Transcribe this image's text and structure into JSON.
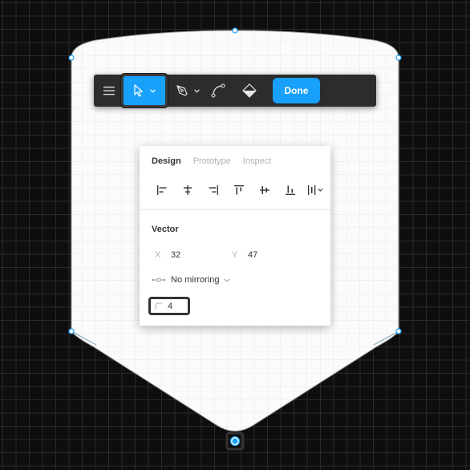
{
  "toolbar": {
    "menu_icon": "hamburger-menu-icon",
    "select_tool_icon": "cursor-arrow-icon",
    "pen_tool_icon": "pen-icon",
    "bend_tool_icon": "bend-curve-icon",
    "fill_tool_icon": "paint-bucket-icon",
    "done_label": "Done"
  },
  "panel": {
    "tabs": [
      {
        "label": "Design",
        "active": true
      },
      {
        "label": "Prototype",
        "active": false
      },
      {
        "label": "Inspect",
        "active": false
      }
    ],
    "align_icons": [
      "align-left-icon",
      "align-horizontal-center-icon",
      "align-right-icon",
      "align-top-icon",
      "align-vertical-center-icon",
      "align-bottom-icon",
      "distribute-icon"
    ],
    "section_title": "Vector",
    "x_label": "X",
    "x_value": "32",
    "y_label": "Y",
    "y_value": "47",
    "mirroring_label": "No mirroring",
    "corner_radius_value": "4"
  },
  "colors": {
    "accent": "#18a0fb",
    "canvas": "#0e0e0e",
    "toolbar": "#2c2c2c"
  }
}
